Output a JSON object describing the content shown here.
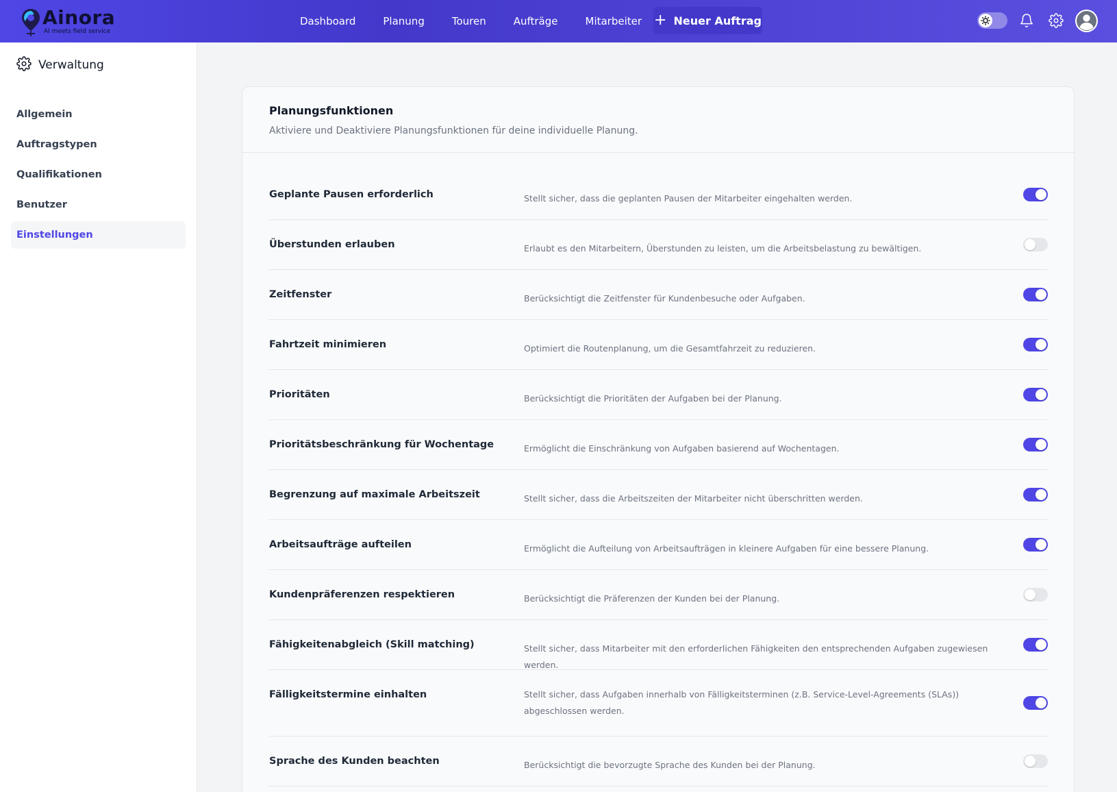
{
  "brand": {
    "name": "Ainora",
    "tagline": "AI meets field service"
  },
  "nav": {
    "items": [
      "Dashboard",
      "Planung",
      "Touren",
      "Aufträge",
      "Mitarbeiter"
    ],
    "new_order_label": "Neuer Auftrag"
  },
  "sidebar": {
    "title": "Verwaltung",
    "items": [
      {
        "label": "Allgemein",
        "active": false
      },
      {
        "label": "Auftragstypen",
        "active": false
      },
      {
        "label": "Qualifikationen",
        "active": false
      },
      {
        "label": "Benutzer",
        "active": false
      },
      {
        "label": "Einstellungen",
        "active": true
      }
    ]
  },
  "section": {
    "title": "Planungsfunktionen",
    "subtitle": "Aktiviere und Deaktiviere Planungsfunktionen für deine individuelle Planung."
  },
  "settings": [
    {
      "label": "Geplante Pausen erforderlich",
      "description": "Stellt sicher, dass die geplanten Pausen der Mitarbeiter eingehalten werden.",
      "enabled": true
    },
    {
      "label": "Überstunden erlauben",
      "description": "Erlaubt es den Mitarbeitern, Überstunden zu leisten, um die Arbeitsbelastung zu bewältigen.",
      "enabled": false
    },
    {
      "label": "Zeitfenster",
      "description": "Berücksichtigt die Zeitfenster für Kundenbesuche oder Aufgaben.",
      "enabled": true
    },
    {
      "label": "Fahrtzeit minimieren",
      "description": "Optimiert die Routenplanung, um die Gesamtfahrzeit zu reduzieren.",
      "enabled": true
    },
    {
      "label": "Prioritäten",
      "description": "Berücksichtigt die Prioritäten der Aufgaben bei der Planung.",
      "enabled": true
    },
    {
      "label": "Prioritätsbeschränkung für Wochentage",
      "description": "Ermöglicht die Einschränkung von Aufgaben basierend auf Wochentagen.",
      "enabled": true
    },
    {
      "label": "Begrenzung auf maximale Arbeitszeit",
      "description": "Stellt sicher, dass die Arbeitszeiten der Mitarbeiter nicht überschritten werden.",
      "enabled": true
    },
    {
      "label": "Arbeitsaufträge aufteilen",
      "description": "Ermöglicht die Aufteilung von Arbeitsaufträgen in kleinere Aufgaben für eine bessere Planung.",
      "enabled": true
    },
    {
      "label": "Kundenpräferenzen respektieren",
      "description": "Berücksichtigt die Präferenzen der Kunden bei der Planung.",
      "enabled": false
    },
    {
      "label": "Fähigkeitenabgleich (Skill matching)",
      "description": "Stellt sicher, dass Mitarbeiter mit den erforderlichen Fähigkeiten den entsprechenden Aufgaben zugewiesen werden.",
      "enabled": true
    },
    {
      "label": "Fälligkeitstermine einhalten",
      "description": "Stellt sicher, dass Aufgaben innerhalb von Fälligkeitsterminen (z.B. Service-Level-Agreements (SLAs)) abgeschlossen werden.",
      "enabled": true
    },
    {
      "label": "Sprache des Kunden beachten",
      "description": "Berücksichtigt die bevorzugte Sprache des Kunden bei der Planung.",
      "enabled": false
    }
  ],
  "icons": {
    "theme_toggle": "sun-icon",
    "notifications": "bell-icon",
    "settings": "gear-icon",
    "profile": "user-avatar-icon",
    "sidebar": "gear-icon",
    "new_order": "plus-icon"
  },
  "colors": {
    "accent": "#4f46e5",
    "toggle_off": "#e5e7eb"
  }
}
